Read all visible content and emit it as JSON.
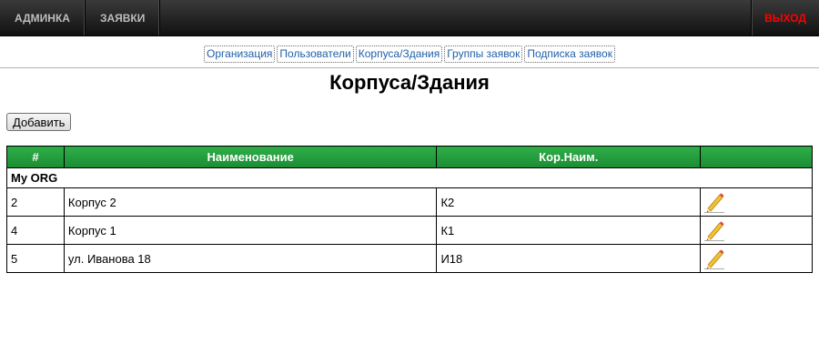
{
  "topbar": {
    "items": [
      "АДМИНКА",
      "ЗАЯВКИ"
    ],
    "logout_label": "ВЫХОД"
  },
  "subnav": {
    "links": [
      "Организация",
      "Пользователи",
      "Корпуса/Здания",
      "Группы заявок",
      "Подписка заявок"
    ]
  },
  "page": {
    "title": "Корпуса/Здания",
    "add_label": "Добавить"
  },
  "table": {
    "headers": [
      "#",
      "Наименование",
      "Кор.Наим.",
      ""
    ],
    "group_label": "My ORG",
    "rows": [
      {
        "id": "2",
        "name": "Корпус 2",
        "short": "К2",
        "action_icon": "pencil-icon"
      },
      {
        "id": "4",
        "name": "Корпус 1",
        "short": "К1",
        "action_icon": "pencil-icon"
      },
      {
        "id": "5",
        "name": "ул. Иванова 18",
        "short": "И18",
        "action_icon": "pencil-icon"
      }
    ]
  },
  "colors": {
    "header_green": "#1a8c33",
    "logout_red": "#ff0000",
    "link_blue": "#1f5fa8"
  }
}
